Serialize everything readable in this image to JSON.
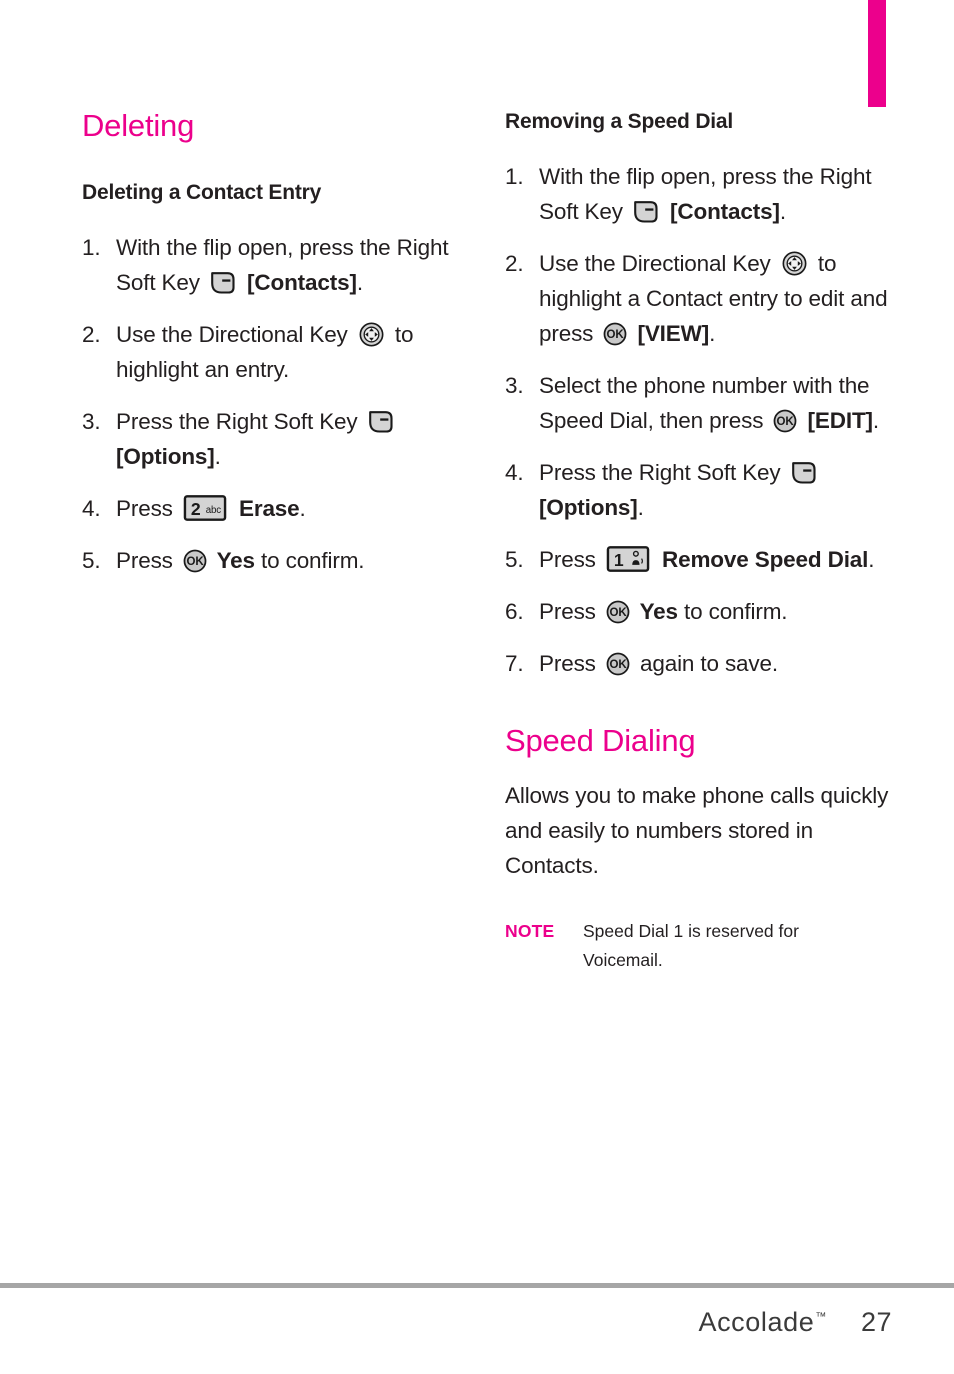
{
  "document": {
    "brand": "Accolade",
    "brand_tm": "™",
    "page_number": "27",
    "accent_color": "#ec008c",
    "text_color": "#231f20",
    "rule_color": "#a6a6a6"
  },
  "left_column": {
    "section_title": "Deleting",
    "sub_title": "Deleting a Contact Entry",
    "steps": [
      {
        "number": "1.",
        "parts": [
          {
            "type": "text",
            "value": "With the flip open, press the Right Soft Key "
          },
          {
            "type": "icon",
            "icon": "soft-key"
          },
          {
            "type": "bold",
            "value": " [Contacts]"
          },
          {
            "type": "text",
            "value": "."
          }
        ]
      },
      {
        "number": "2.",
        "parts": [
          {
            "type": "text",
            "value": "Use the Directional Key "
          },
          {
            "type": "icon",
            "icon": "directional-key"
          },
          {
            "type": "text",
            "value": " to highlight an entry."
          }
        ]
      },
      {
        "number": "3.",
        "parts": [
          {
            "type": "text",
            "value": "Press the Right Soft Key "
          },
          {
            "type": "icon",
            "icon": "soft-key"
          },
          {
            "type": "bold",
            "value": " [Options]"
          },
          {
            "type": "text",
            "value": "."
          }
        ]
      },
      {
        "number": "4.",
        "parts": [
          {
            "type": "text",
            "value": "Press "
          },
          {
            "type": "icon",
            "icon": "key-2-abc"
          },
          {
            "type": "bold",
            "value": " Erase"
          },
          {
            "type": "text",
            "value": "."
          }
        ]
      },
      {
        "number": "5.",
        "parts": [
          {
            "type": "text",
            "value": "Press "
          },
          {
            "type": "icon",
            "icon": "ok-key"
          },
          {
            "type": "bold",
            "value": " Yes"
          },
          {
            "type": "text",
            "value": " to confirm."
          }
        ]
      }
    ]
  },
  "right_column": {
    "sub_title": "Removing a Speed Dial",
    "steps": [
      {
        "number": "1.",
        "parts": [
          {
            "type": "text",
            "value": "With the flip open, press the Right Soft Key "
          },
          {
            "type": "icon",
            "icon": "soft-key"
          },
          {
            "type": "bold",
            "value": " [Contacts]"
          },
          {
            "type": "text",
            "value": "."
          }
        ]
      },
      {
        "number": "2.",
        "parts": [
          {
            "type": "text",
            "value": "Use the Directional Key "
          },
          {
            "type": "icon",
            "icon": "directional-key"
          },
          {
            "type": "text",
            "value": " to highlight a Contact entry to edit and press "
          },
          {
            "type": "icon",
            "icon": "ok-key"
          },
          {
            "type": "bold",
            "value": " [VIEW]"
          },
          {
            "type": "text",
            "value": "."
          }
        ]
      },
      {
        "number": "3.",
        "parts": [
          {
            "type": "text",
            "value": "Select the phone number with the Speed Dial, then press "
          },
          {
            "type": "icon",
            "icon": "ok-key"
          },
          {
            "type": "bold",
            "value": " [EDIT]"
          },
          {
            "type": "text",
            "value": "."
          }
        ]
      },
      {
        "number": "4.",
        "parts": [
          {
            "type": "text",
            "value": "Press the Right Soft Key "
          },
          {
            "type": "icon",
            "icon": "soft-key"
          },
          {
            "type": "bold",
            "value": " [Options]"
          },
          {
            "type": "text",
            "value": "."
          }
        ]
      },
      {
        "number": "5.",
        "parts": [
          {
            "type": "text",
            "value": "Press "
          },
          {
            "type": "icon",
            "icon": "key-1-voicemail"
          },
          {
            "type": "bold",
            "value": " Remove Speed Dial"
          },
          {
            "type": "text",
            "value": "."
          }
        ]
      },
      {
        "number": "6.",
        "parts": [
          {
            "type": "text",
            "value": "Press "
          },
          {
            "type": "icon",
            "icon": "ok-key"
          },
          {
            "type": "bold",
            "value": " Yes"
          },
          {
            "type": "text",
            "value": " to confirm."
          }
        ]
      },
      {
        "number": "7.",
        "parts": [
          {
            "type": "text",
            "value": "Press "
          },
          {
            "type": "icon",
            "icon": "ok-key"
          },
          {
            "type": "text",
            "value": " again to save."
          }
        ]
      }
    ],
    "section_title": "Speed Dialing",
    "body_text": "Allows you to make phone calls quickly and easily to numbers stored in Contacts.",
    "note": {
      "label": "NOTE",
      "text": "Speed Dial 1 is reserved for Voicemail."
    }
  },
  "icons": {
    "key-2-abc": {
      "digit": "2",
      "letters": "abc"
    },
    "key-1-voicemail": {
      "digit": "1",
      "letters": ""
    },
    "ok-key": {
      "label": "OK"
    }
  }
}
